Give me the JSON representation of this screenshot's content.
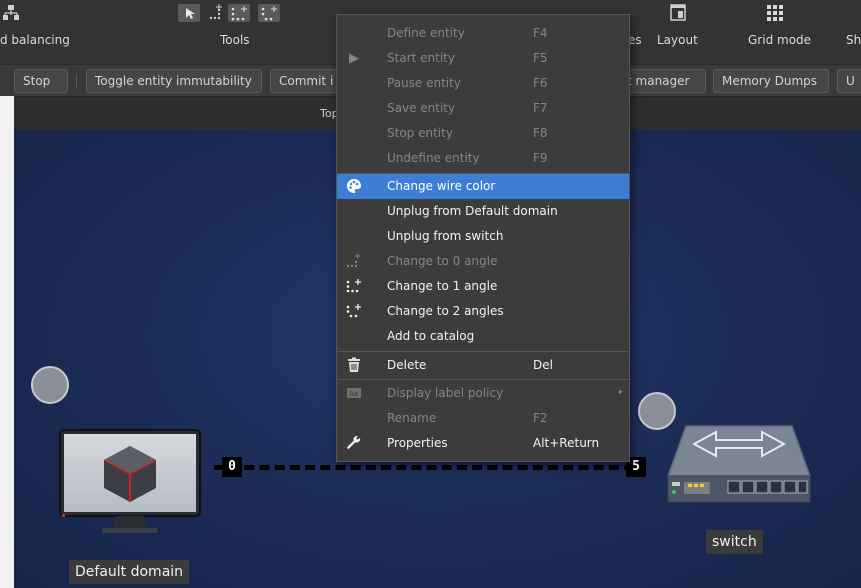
{
  "toolbar": {
    "groups": [
      {
        "label": "d balancing"
      },
      {
        "label": "Tools"
      },
      {
        "label": "es"
      },
      {
        "label": "Layout"
      },
      {
        "label": "Grid mode"
      },
      {
        "label": "Sh"
      }
    ]
  },
  "buttons": [
    {
      "label": "Stop"
    },
    {
      "label": "Toggle entity immutability"
    },
    {
      "label": "Commit i"
    },
    {
      "label": "t manager"
    },
    {
      "label": "Memory Dumps"
    },
    {
      "label": "U"
    }
  ],
  "panel": {
    "title": "Top"
  },
  "context_menu": {
    "items": [
      {
        "label": "Define entity",
        "shortcut": "F4",
        "enabled": false
      },
      {
        "label": "Start entity",
        "shortcut": "F5",
        "enabled": false,
        "icon": "play-icon"
      },
      {
        "label": "Pause entity",
        "shortcut": "F6",
        "enabled": false
      },
      {
        "label": "Save entity",
        "shortcut": "F7",
        "enabled": false
      },
      {
        "label": "Stop entity",
        "shortcut": "F8",
        "enabled": false
      },
      {
        "label": "Undefine entity",
        "shortcut": "F9",
        "enabled": false
      },
      {
        "label": "Change wire color",
        "shortcut": "",
        "enabled": true,
        "highlighted": true,
        "icon": "palette-icon"
      },
      {
        "label": "Unplug from Default domain",
        "shortcut": "",
        "enabled": true
      },
      {
        "label": "Unplug from switch",
        "shortcut": "",
        "enabled": true
      },
      {
        "label": "Change to 0 angle",
        "shortcut": "",
        "enabled": false,
        "icon": "angle-0-icon"
      },
      {
        "label": "Change to 1 angle",
        "shortcut": "",
        "enabled": true,
        "icon": "angle-1-icon"
      },
      {
        "label": "Change to 2 angles",
        "shortcut": "",
        "enabled": true,
        "icon": "angle-2-icon"
      },
      {
        "label": "Add to catalog",
        "shortcut": "",
        "enabled": true
      },
      {
        "label": "Delete",
        "shortcut": "Del",
        "enabled": true,
        "icon": "trash-icon"
      },
      {
        "label": "Display label policy",
        "shortcut": "",
        "enabled": false,
        "icon": "label-icon",
        "submenu": true
      },
      {
        "label": "Rename",
        "shortcut": "F2",
        "enabled": false
      },
      {
        "label": "Properties",
        "shortcut": "Alt+Return",
        "enabled": true,
        "icon": "wrench-icon"
      }
    ]
  },
  "canvas": {
    "nodes": [
      {
        "label": "Default domain"
      },
      {
        "label": "switch"
      }
    ],
    "link": {
      "source_port": "0",
      "target_port": "5"
    }
  },
  "colors": {
    "highlight": "#3d7dd6",
    "canvas": "#1b2b55",
    "link": "#000000"
  }
}
